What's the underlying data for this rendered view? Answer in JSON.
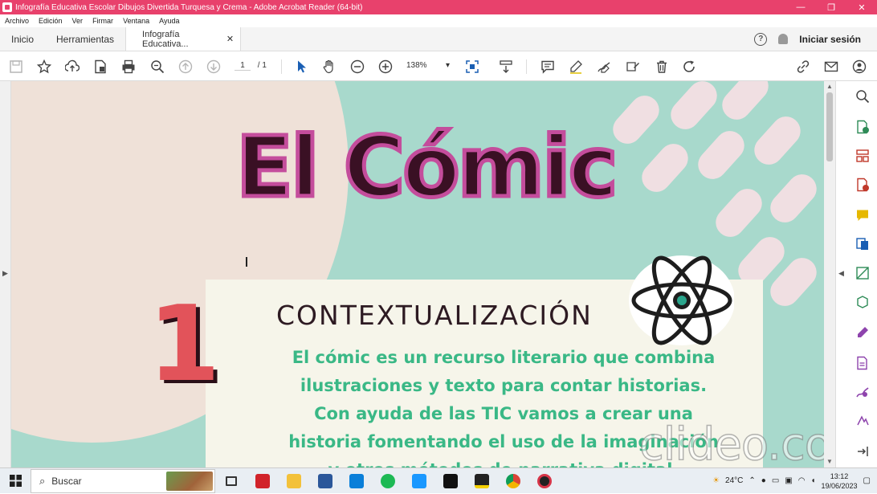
{
  "window": {
    "title": "Infografía Educativa Escolar Dibujos Divertida Turquesa y Crema - Adobe Acrobat Reader (64-bit)",
    "minimize": "—",
    "restore": "❐",
    "close": "✕"
  },
  "menu": [
    "Archivo",
    "Edición",
    "Ver",
    "Firmar",
    "Ventana",
    "Ayuda"
  ],
  "tabs": {
    "home": "Inicio",
    "tools": "Herramientas",
    "document": "Infografía Educativa...",
    "close": "✕",
    "help": "?",
    "signin": "Iniciar sesión"
  },
  "toolbar": {
    "page_current": "1",
    "page_total": "/ 1",
    "zoom": "138%"
  },
  "document": {
    "title": "El Cómic",
    "number": "1",
    "section_title": "CONTEXTUALIZACIÓN",
    "body_lines": [
      "El cómic es un recurso literario que combina",
      "ilustraciones y texto para contar historias.",
      "Con  ayuda de las TIC vamos a crear una",
      "historia fomentando el uso de la imaginación",
      "y otros métodos de narrativa digital."
    ],
    "watermark": "clideo.com"
  },
  "taskbar": {
    "search_placeholder": "Buscar",
    "temperature": "24°C",
    "time": "13:12",
    "date": "19/06/2023"
  },
  "colors": {
    "titlebar": "#e8416c",
    "page_teal": "#a8d9cc",
    "cream": "#efe1d8",
    "text_green": "#3ab886",
    "accent_pink": "#e2535a"
  }
}
